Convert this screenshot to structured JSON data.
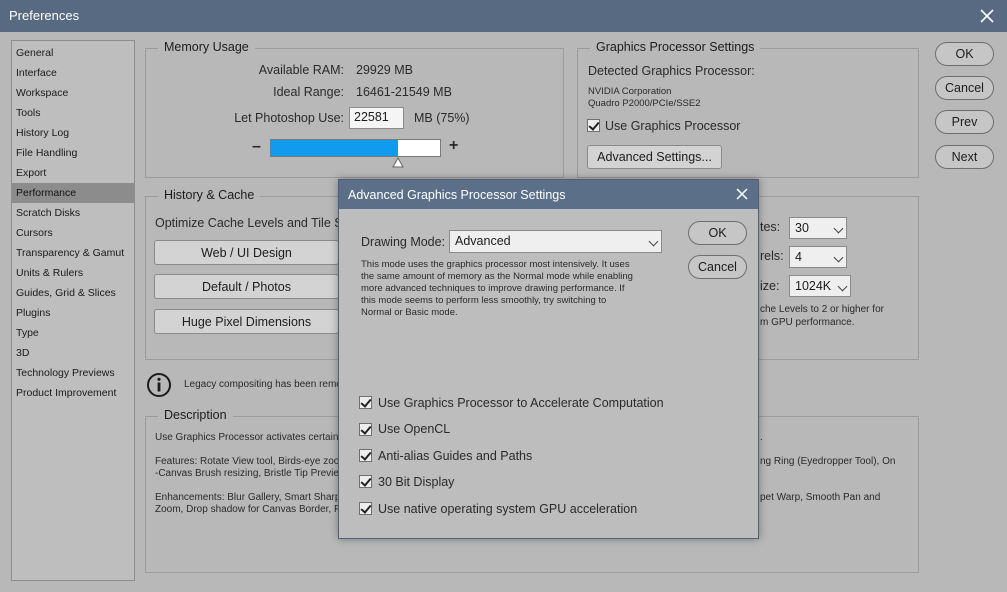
{
  "window": {
    "title": "Preferences"
  },
  "sidebar": {
    "items": [
      {
        "label": "General"
      },
      {
        "label": "Interface"
      },
      {
        "label": "Workspace"
      },
      {
        "label": "Tools"
      },
      {
        "label": "History Log"
      },
      {
        "label": "File Handling"
      },
      {
        "label": "Export"
      },
      {
        "label": "Performance"
      },
      {
        "label": "Scratch Disks"
      },
      {
        "label": "Cursors"
      },
      {
        "label": "Transparency & Gamut"
      },
      {
        "label": "Units & Rulers"
      },
      {
        "label": "Guides, Grid & Slices"
      },
      {
        "label": "Plugins"
      },
      {
        "label": "Type"
      },
      {
        "label": "3D"
      },
      {
        "label": "Technology Previews"
      },
      {
        "label": "Product Improvement"
      }
    ],
    "selected": "Performance"
  },
  "memory": {
    "legend": "Memory Usage",
    "available_label": "Available RAM:",
    "available_value": "29929 MB",
    "ideal_label": "Ideal Range:",
    "ideal_value": "16461-21549 MB",
    "let_label": "Let Photoshop Use:",
    "let_value": "22581",
    "let_suffix": "MB (75%)",
    "minus": "–",
    "plus": "+",
    "slider_fraction": 0.75
  },
  "gpu": {
    "legend": "Graphics Processor Settings",
    "detected_label": "Detected Graphics Processor:",
    "vendor": "NVIDIA Corporation",
    "model": "Quadro P2000/PCIe/SSE2",
    "use_gpu_label": "Use Graphics Processor",
    "advanced_button": "Advanced Settings..."
  },
  "buttons": {
    "ok": "OK",
    "cancel": "Cancel",
    "prev": "Prev",
    "next": "Next"
  },
  "history": {
    "legend": "History & Cache",
    "optimize_text": "Optimize Cache Levels and Tile S",
    "web_ui": "Web / UI Design",
    "default_photos": "Default / Photos",
    "huge_pixel": "Huge Pixel Dimensions",
    "states_label": "tes:",
    "states_value": "30",
    "levels_label": "rels:",
    "levels_value": "4",
    "tile_label": "ize:",
    "tile_value": "1024K",
    "note_line1": "che Levels to 2 or higher for",
    "note_line2": "m GPU performance."
  },
  "legacy": {
    "text": "Legacy compositing has been remo"
  },
  "description": {
    "legend": "Description",
    "line1_left": "Use Graphics Processor activates certain",
    "line1_right": ".",
    "features_left1": "Features: Rotate View tool, Birds-eye zoor",
    "features_left2": "-Canvas Brush resizing, Bristle Tip Previe",
    "features_right": "ng Ring (Eyedropper Tool), On",
    "enh_left1": "Enhancements: Blur Gallery, Smart Sharp",
    "enh_left2": "Zoom, Drop shadow for Canvas Border, P",
    "enh_right": "pet Warp, Smooth Pan and"
  },
  "dialog": {
    "title": "Advanced Graphics Processor Settings",
    "drawing_mode_label": "Drawing Mode:",
    "drawing_mode_value": "Advanced",
    "desc_lines": [
      "This mode uses the graphics processor most intensively.  It uses",
      "the same amount of memory as the Normal mode while enabling",
      "more advanced techniques to improve drawing performance.  If",
      "this mode seems to perform less smoothly, try switching to",
      "Normal or Basic mode."
    ],
    "ok": "OK",
    "cancel": "Cancel",
    "options": [
      {
        "label": "Use Graphics Processor to Accelerate Computation",
        "checked": true
      },
      {
        "label": "Use OpenCL",
        "checked": true
      },
      {
        "label": "Anti-alias Guides and Paths",
        "checked": true
      },
      {
        "label": "30 Bit Display",
        "checked": true
      },
      {
        "label": "Use native operating system GPU acceleration",
        "checked": true
      }
    ]
  },
  "colors": {
    "titlebar": "#576a82",
    "slider_fill": "#109bef",
    "selected_item": "#8c8c8c"
  }
}
